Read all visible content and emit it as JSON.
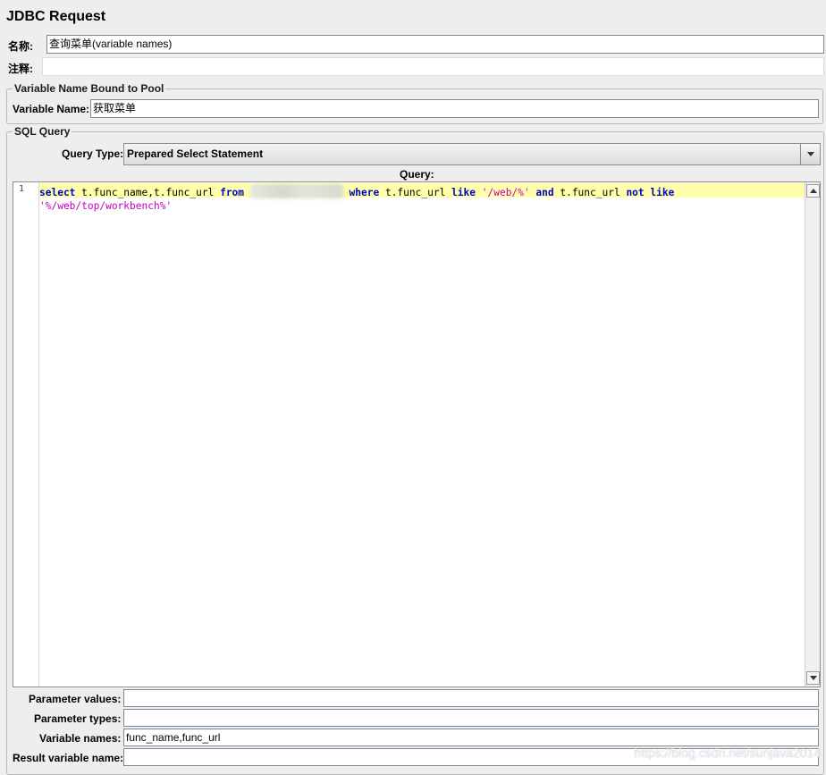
{
  "panel_title": "JDBC Request",
  "name_label": "名称:",
  "name_value": "查询菜单(variable names)",
  "comment_label": "注释:",
  "comment_value": "",
  "pool_group": {
    "legend": "Variable Name Bound to Pool",
    "label": "Variable Name:",
    "value": "获取菜单"
  },
  "sql_group": {
    "legend": "SQL Query",
    "query_type_label": "Query Type:",
    "query_type_value": "Prepared Select Statement",
    "query_label": "Query:",
    "line_number": "1",
    "query_tokens": {
      "t1": "select",
      "t2": " t.func_name,t.func_url ",
      "t3": "from",
      "t5": "where",
      "t6": " t.func_url ",
      "t7": "like",
      "t8": "'/web/%'",
      "t9": "and",
      "t10": " t.func_url ",
      "t11": "not",
      "t12": "like",
      "t13": "'%/web/top/workbench%'"
    }
  },
  "params": {
    "values_label": "Parameter values:",
    "values_value": "",
    "types_label": "Parameter types:",
    "types_value": "",
    "varnames_label": "Variable names:",
    "varnames_value": "func_name,func_url",
    "result_label": "Result variable name:",
    "result_value": ""
  },
  "watermark": "https://blog.csdn.net/sunjava2014",
  "colors": {
    "keyword": "#0000cc",
    "string": "#c000c0",
    "current_line": "#ffffaa",
    "panel_bg": "#eeeeee"
  }
}
